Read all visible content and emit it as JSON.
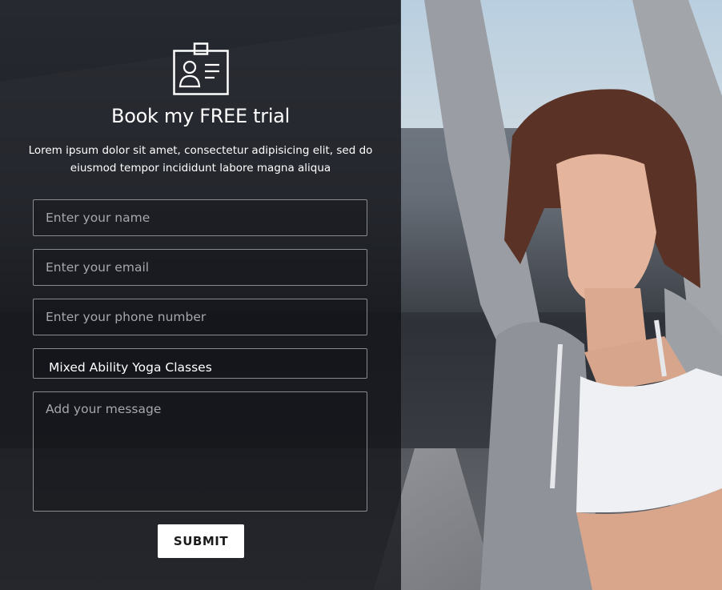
{
  "form": {
    "title": "Book my FREE trial",
    "description": "Lorem ipsum dolor sit amet, consectetur adipisicing elit, sed do eiusmod tempor incididunt labore magna aliqua",
    "name_placeholder": "Enter your name",
    "email_placeholder": "Enter your email",
    "phone_placeholder": "Enter your phone number",
    "class_selected": "Mixed Ability Yoga Classes",
    "message_placeholder": "Add your message",
    "submit_label": "SUBMIT"
  },
  "icons": {
    "header_icon": "id-badge-icon"
  },
  "colors": {
    "panel_overlay": "#121318",
    "text": "#ffffff",
    "field_border": "#8a8b90",
    "button_bg": "#ffffff"
  }
}
